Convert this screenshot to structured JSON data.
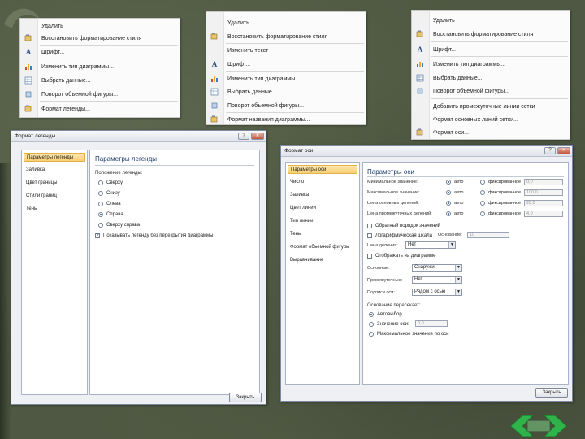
{
  "menu1": {
    "items": [
      {
        "label": "Удалить",
        "icon": "delete-icon"
      },
      {
        "label": "Восстановить форматирование стиля",
        "icon": "reset-style-icon"
      },
      {
        "label": "Шрифт...",
        "icon": "font-icon"
      },
      {
        "label": "Изменить тип диаграммы...",
        "icon": "chart-type-icon"
      },
      {
        "label": "Выбрать данные...",
        "icon": "select-data-icon"
      },
      {
        "label": "Поворот объемной фигуры...",
        "icon": "rotate-3d-icon"
      },
      {
        "label": "Формат легенды...",
        "icon": "format-legend-icon"
      }
    ]
  },
  "menu2": {
    "items": [
      {
        "label": "Удалить",
        "icon": "delete-icon"
      },
      {
        "label": "Восстановить форматирование стиля",
        "icon": "reset-style-icon"
      },
      {
        "label": "Изменить текст",
        "icon": "edit-text-icon"
      },
      {
        "label": "Шрифт...",
        "icon": "font-icon"
      },
      {
        "label": "Изменить тип диаграммы...",
        "icon": "chart-type-icon"
      },
      {
        "label": "Выбрать данные...",
        "icon": "select-data-icon"
      },
      {
        "label": "Поворот объемной фигуры...",
        "icon": "rotate-3d-icon"
      },
      {
        "label": "Формат названия диаграммы...",
        "icon": "format-title-icon"
      }
    ]
  },
  "menu3": {
    "items": [
      {
        "label": "Удалить",
        "icon": "delete-icon"
      },
      {
        "label": "Восстановить форматирование стиля",
        "icon": "reset-style-icon"
      },
      {
        "label": "Шрифт...",
        "icon": "font-icon"
      },
      {
        "label": "Изменить тип диаграммы...",
        "icon": "chart-type-icon"
      },
      {
        "label": "Выбрать данные...",
        "icon": "select-data-icon"
      },
      {
        "label": "Поворот объемной фигуры...",
        "icon": "rotate-3d-icon"
      },
      {
        "label": "Добавить промежуточные линии сетки",
        "icon": ""
      },
      {
        "label": "Формат основных линий сетки...",
        "icon": ""
      },
      {
        "label": "Формат оси...",
        "icon": "format-axis-icon"
      }
    ]
  },
  "legend_dialog": {
    "title": "Формат легенды",
    "nav": [
      "Параметры легенды",
      "Заливка",
      "Цвет границы",
      "Стили границ",
      "Тень"
    ],
    "pane_title": "Параметры легенды",
    "position_label": "Положение легенды:",
    "positions": [
      {
        "label": "Сверху",
        "selected": false
      },
      {
        "label": "Снизу",
        "selected": false
      },
      {
        "label": "Слева",
        "selected": false
      },
      {
        "label": "Справа",
        "selected": true
      },
      {
        "label": "Сверху справа",
        "selected": false
      }
    ],
    "overlap_label": "Показывать легенду без перекрытия диаграммы",
    "close_button": "Закрыть"
  },
  "axis_dialog": {
    "title": "Формат оси",
    "nav": [
      "Параметры оси",
      "Число",
      "Заливка",
      "Цвет линии",
      "Тип линии",
      "Тень",
      "Формат объемной фигуры",
      "Выравнивание"
    ],
    "pane_title": "Параметры оси",
    "rows": [
      {
        "label": "Минимальное значение:",
        "auto": "авто",
        "fixed": "фиксированное",
        "value": "0,0"
      },
      {
        "label": "Максимальное значение:",
        "auto": "авто",
        "fixed": "фиксированное",
        "value": "100,0"
      },
      {
        "label": "Цена основных делений:",
        "auto": "авто",
        "fixed": "фиксированное",
        "value": "20,0"
      },
      {
        "label": "Цена промежуточных делений:",
        "auto": "авто",
        "fixed": "фиксированное",
        "value": "4,0"
      }
    ],
    "reverse_label": "Обратный порядок значений",
    "log_label": "Логарифмическая шкала",
    "log_base_label": "Основание:",
    "log_base_value": "10",
    "units_label": "Цена деления:",
    "units_value": "Нет",
    "show_units_label": "Отображать на диаграмме",
    "major_tick_label": "Основные:",
    "major_tick_value": "Снаружи",
    "minor_tick_label": "Промежуточные:",
    "minor_tick_value": "Нет",
    "axis_labels_label": "Подписи оси:",
    "axis_labels_value": "Рядом с осью",
    "crosses_label": "Основание пересекает:",
    "crosses_options": [
      {
        "label": "Автовыбор",
        "selected": true
      },
      {
        "label": "Значение оси:",
        "selected": false,
        "value": "0,0"
      },
      {
        "label": "Максимальное значение по оси",
        "selected": false
      }
    ],
    "close_button": "Закрыть"
  },
  "colors": {
    "accent": "#f9cf71",
    "title_blue": "#1f3c6d",
    "nav_arrow": "#2fb34a"
  }
}
